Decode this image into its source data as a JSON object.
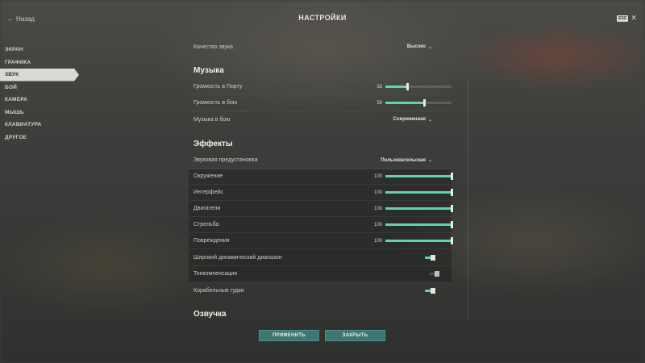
{
  "header": {
    "back_label": "Назад",
    "title": "НАСТРОЙКИ",
    "esc_label": "ESC"
  },
  "sidebar": {
    "items": [
      {
        "label": "ЭКРАН"
      },
      {
        "label": "ГРАФИКА"
      },
      {
        "label": "ЗВУК"
      },
      {
        "label": "БОЙ"
      },
      {
        "label": "КАМЕРА"
      },
      {
        "label": "МЫШЬ"
      },
      {
        "label": "КЛАВИАТУРА"
      },
      {
        "label": "ДРУГОЕ"
      }
    ],
    "active_index": 2
  },
  "settings": {
    "sound_quality": {
      "label": "Качество звука",
      "value": "Высоко"
    },
    "music": {
      "title": "Музыка",
      "port_volume": {
        "label": "Громкость в Порту",
        "value": "33",
        "percent": 33
      },
      "battle_volume": {
        "label": "Громкость в бою",
        "value": "59",
        "percent": 59
      },
      "battle_music": {
        "label": "Музыка в бою",
        "value": "Современная"
      }
    },
    "effects": {
      "title": "Эффекты",
      "preset": {
        "label": "Звуковая предустановка",
        "value": "Пользовательская"
      },
      "sliders": [
        {
          "label": "Окружение",
          "value": "100",
          "percent": 100
        },
        {
          "label": "Интерфейс",
          "value": "100",
          "percent": 100
        },
        {
          "label": "Двигатели",
          "value": "100",
          "percent": 100
        },
        {
          "label": "Стрельба",
          "value": "100",
          "percent": 100
        },
        {
          "label": "Повреждения",
          "value": "100",
          "percent": 100
        }
      ],
      "wide_range": {
        "label": "Широкий динамический диапазон",
        "on": true
      },
      "loudness": {
        "label": "Тонкомпенсация",
        "on": false
      },
      "horns": {
        "label": "Корабельные гудки",
        "on": true
      }
    },
    "voice": {
      "title": "Озвучка"
    }
  },
  "footer": {
    "apply_label": "ПРИМЕНИТЬ",
    "close_label": "ЗАКРЫТЬ"
  },
  "colors": {
    "accent": "#5fd3ae",
    "button": "#3f7673"
  }
}
